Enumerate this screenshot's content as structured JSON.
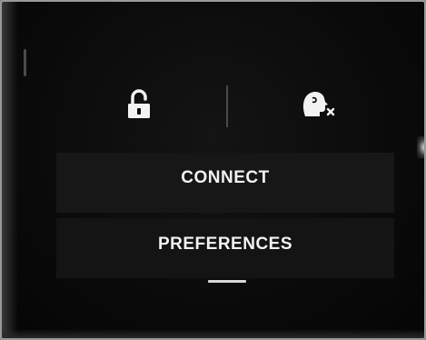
{
  "menu": {
    "items": [
      {
        "label": "CONNECT",
        "icon": "none"
      },
      {
        "label": "PREFERENCES",
        "icon": "none"
      }
    ]
  },
  "status": {
    "left_icon": "unlocked-padlock-icon",
    "right_icon": "driver-voice-off-icon"
  },
  "page_indicator": {
    "current_page": 1
  },
  "colors": {
    "background": "#0b0b0b",
    "menu_item_bg": "#171717",
    "text": "#f2f2f2"
  }
}
